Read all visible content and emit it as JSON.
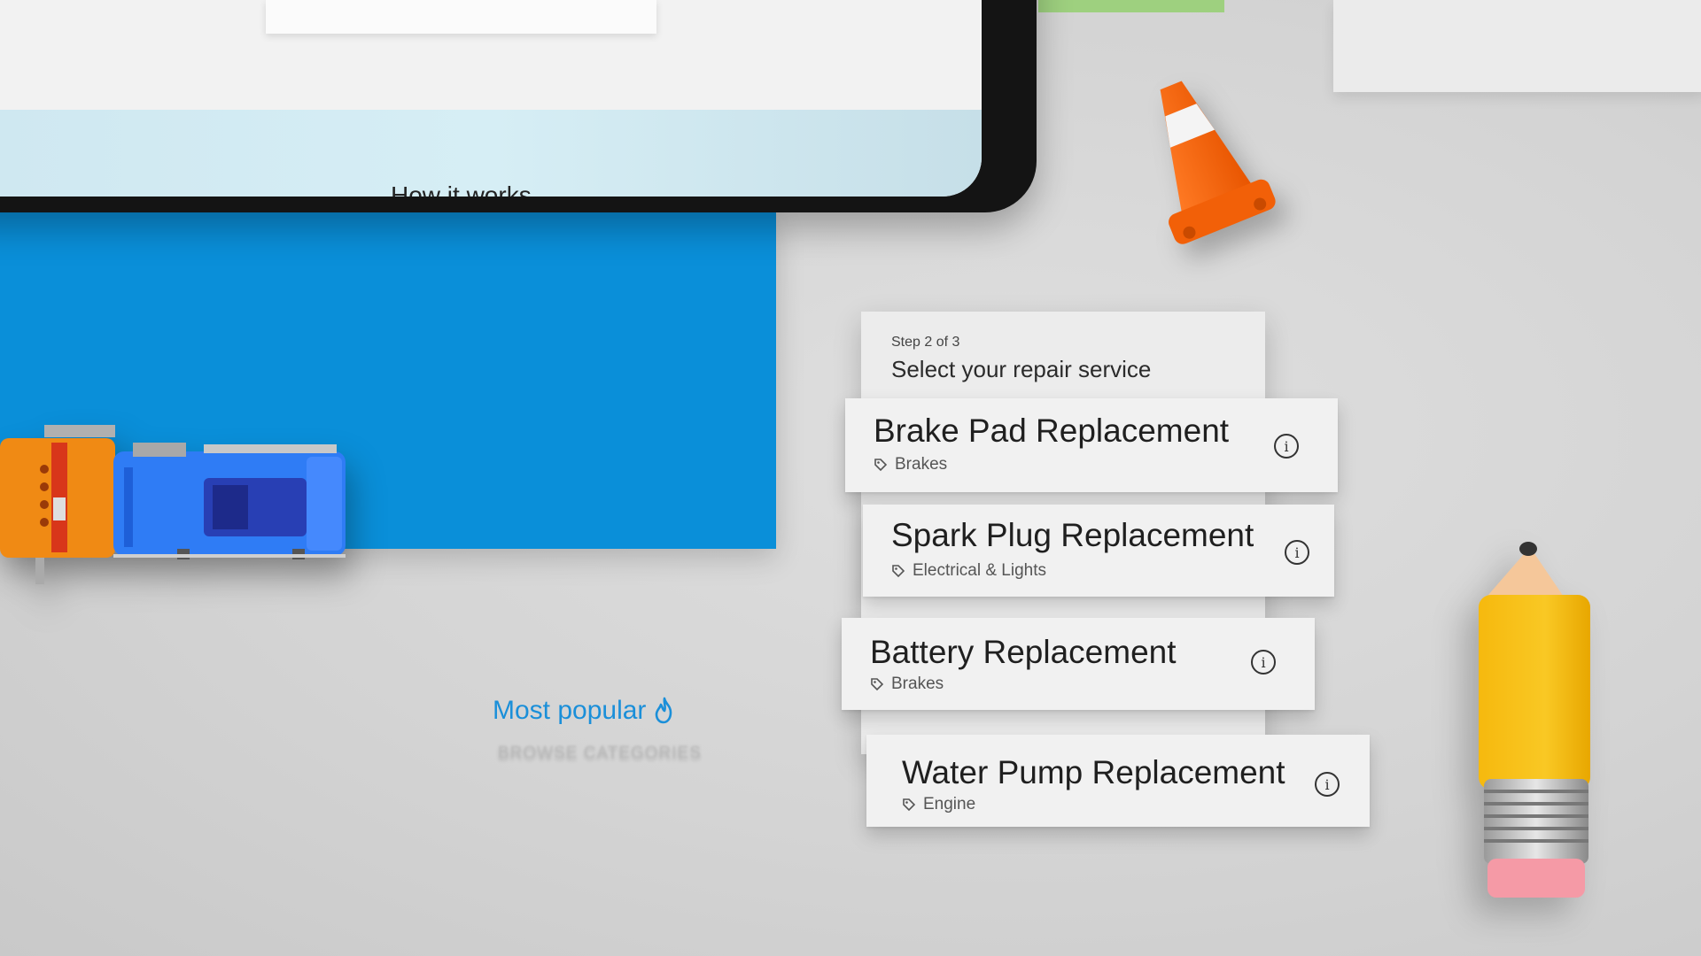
{
  "tablet": {
    "heading": "How it works"
  },
  "flow": {
    "step_label": "Step 2 of 3",
    "title": "Select your repair service"
  },
  "services": [
    {
      "name": "Brake Pad Replacement",
      "category": "Brakes",
      "icon": "tag-icon",
      "action_icon": "info-icon"
    },
    {
      "name": "Spark Plug Replacement",
      "category": "Electrical & Lights",
      "icon": "tag-icon",
      "action_icon": "info-icon"
    },
    {
      "name": "Battery Replacement",
      "category": "Brakes",
      "icon": "tag-icon",
      "action_icon": "info-icon"
    },
    {
      "name": "Water Pump Replacement",
      "category": "Engine",
      "icon": "tag-icon",
      "action_icon": "info-icon"
    }
  ],
  "popular": {
    "label": "Most popular",
    "icon": "flame-icon",
    "sub_label": "BROWSE CATEGORIES"
  },
  "colors": {
    "accent_blue": "#0a8fd9",
    "link_blue": "#1a8fd9",
    "card_bg": "#f1f1f1",
    "green_strip": "#9ed07f",
    "cone_orange": "#ff6a14",
    "pencil_yellow": "#f7c21a"
  }
}
